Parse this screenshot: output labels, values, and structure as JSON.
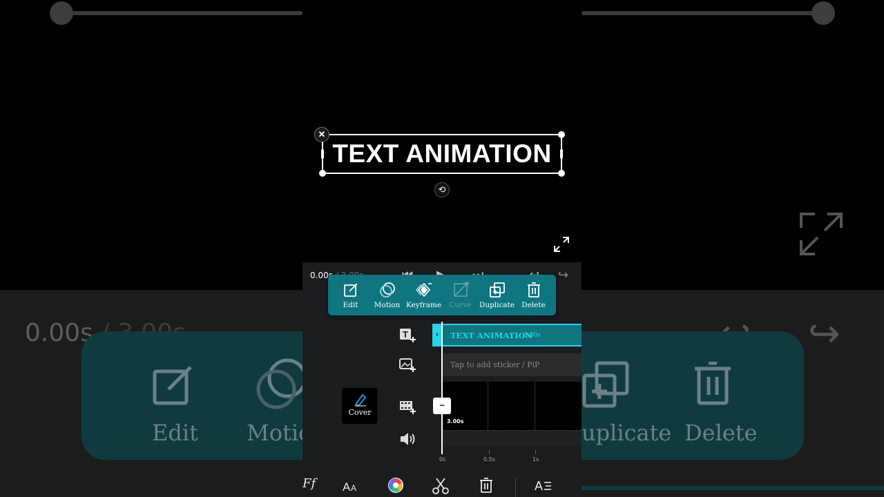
{
  "preview": {
    "overlay_text": "TEXT ANIMATION",
    "close_icon_glyph": "✕",
    "rotate_icon_glyph": "⟲"
  },
  "playback": {
    "current_time": "0.00s",
    "total_time": "/ 3.00s"
  },
  "action_toolbar": {
    "items": [
      {
        "label": "Edit",
        "icon": "edit-icon",
        "enabled": true
      },
      {
        "label": "Motion",
        "icon": "motion-icon",
        "enabled": true
      },
      {
        "label": "Keyframe",
        "icon": "keyframe-icon",
        "enabled": true
      },
      {
        "label": "Curve",
        "icon": "curve-icon",
        "enabled": false
      },
      {
        "label": "Duplicate",
        "icon": "duplicate-icon",
        "enabled": true
      },
      {
        "label": "Delete",
        "icon": "delete-icon",
        "enabled": true
      }
    ]
  },
  "timeline": {
    "text_clip_label": "TEXT ANIMATION",
    "text_clip_duration": "3.00s",
    "sticker_placeholder": "Tap to add sticker / PiP",
    "video_duration": "3.00s",
    "ruler": [
      "0s",
      "0.5s",
      "1s"
    ],
    "cover_label": "Cover"
  },
  "background_mirror": {
    "time": "0.00s",
    "time_total": "/ 3.00s",
    "labels": [
      "Edit",
      "Motio",
      "uplicate",
      "Delete"
    ]
  },
  "colors": {
    "accent": "#27d4e8",
    "toolbar": "#0f7580",
    "panel_bg": "#1b1c1d"
  }
}
